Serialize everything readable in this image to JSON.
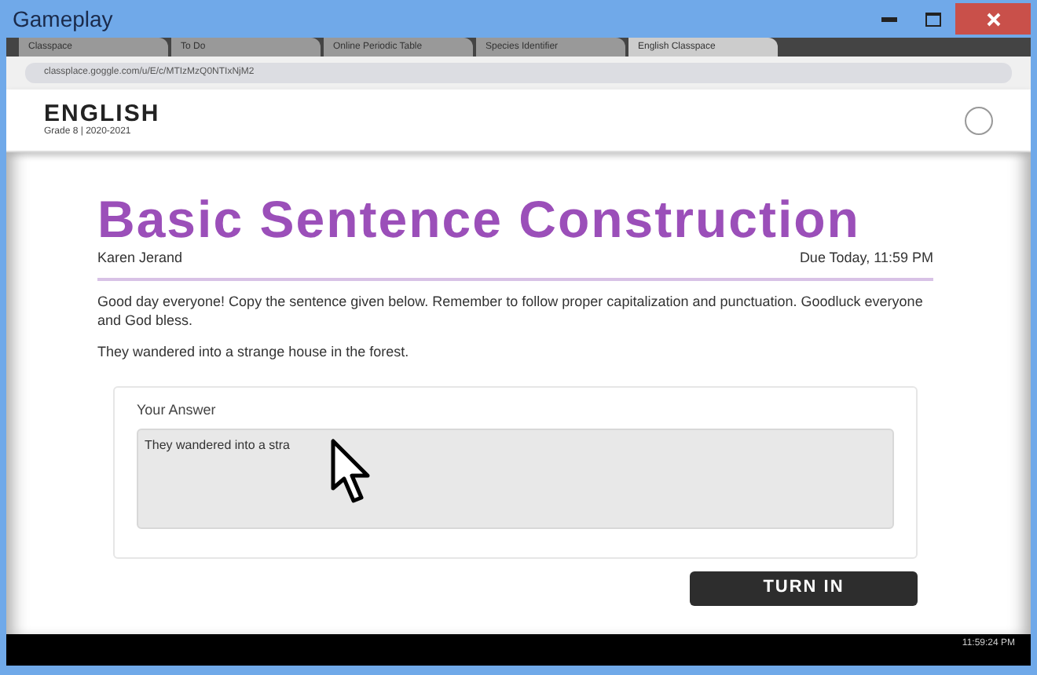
{
  "window": {
    "title": "Gameplay"
  },
  "tabs": [
    {
      "label": "Classpace",
      "selected": false
    },
    {
      "label": "To Do",
      "selected": false
    },
    {
      "label": "Online Periodic Table",
      "selected": false
    },
    {
      "label": "Species Identifier",
      "selected": false
    },
    {
      "label": "English Classpace",
      "selected": true
    }
  ],
  "address": "classplace.goggle.com/u/E/c/MTIzMzQ0NTIxNjM2",
  "course": {
    "name": "ENGLISH",
    "subtitle": "Grade 8 | 2020-2021"
  },
  "assignment": {
    "title": "Basic Sentence Construction",
    "teacher": "Karen Jerand",
    "due": "Due Today, 11:59 PM",
    "instructions": "Good day everyone! Copy the sentence given below. Remember to follow proper capitalization and punctuation. Goodluck everyone and God bless.",
    "sentence": "They wandered into a strange house in the forest."
  },
  "answer": {
    "label": "Your Answer",
    "value": "They wandered into a stra"
  },
  "submit": "TURN IN",
  "taskbar": {
    "time": "11:59:24 PM"
  }
}
